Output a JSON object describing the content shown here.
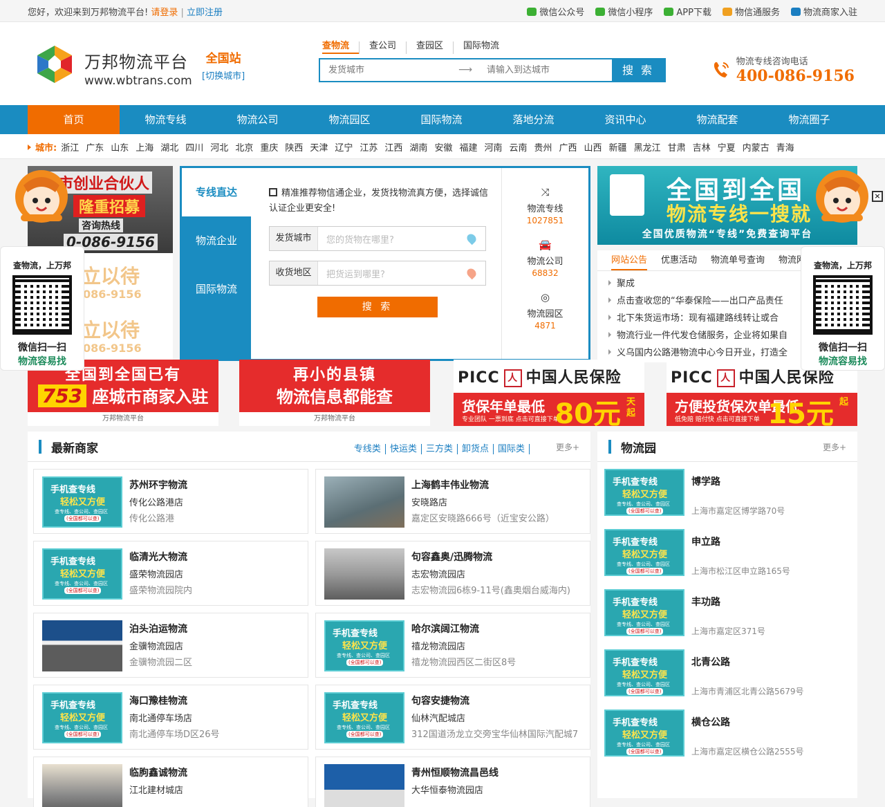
{
  "topbar": {
    "greeting": "您好，欢迎来到万邦物流平台!",
    "login": "请登录",
    "sep": "|",
    "register": "立即注册",
    "links": [
      {
        "icon": "wechat-icon",
        "label": "微信公众号",
        "color": "#3cb034"
      },
      {
        "icon": "miniprogram-icon",
        "label": "微信小程序",
        "color": "#3cb034"
      },
      {
        "icon": "download-icon",
        "label": "APP下载",
        "color": "#3cb034"
      },
      {
        "icon": "truck-icon",
        "label": "物信通服务",
        "color": "#f0a020"
      },
      {
        "icon": "merchant-icon",
        "label": "物流商家入驻",
        "color": "#1a7ec1"
      }
    ]
  },
  "header": {
    "logo_cn": "万邦物流平台",
    "logo_en": "www.wbtrans.com",
    "station": "全国站",
    "switch_city": "[切换城市]",
    "search_tabs": [
      "查物流",
      "查公司",
      "查园区",
      "国际物流"
    ],
    "from_placeholder": "发货城市",
    "to_placeholder": "请输入到达城市",
    "search_btn": "搜 索",
    "hotline_label": "物流专线咨询电话",
    "hotline": "400-086-9156",
    "accent": "#f06c00",
    "brand": "#1a8cc1"
  },
  "nav": [
    "首页",
    "物流专线",
    "物流公司",
    "物流园区",
    "国际物流",
    "落地分流",
    "资讯中心",
    "物流配套",
    "物流圈子"
  ],
  "cities": {
    "label": "城市:",
    "list": [
      "浙江",
      "广东",
      "山东",
      "上海",
      "湖北",
      "四川",
      "河北",
      "北京",
      "重庆",
      "陕西",
      "天津",
      "辽宁",
      "江苏",
      "江西",
      "湖南",
      "安徽",
      "福建",
      "河南",
      "云南",
      "贵州",
      "广西",
      "山西",
      "新疆",
      "黑龙江",
      "甘肃",
      "吉林",
      "宁夏",
      "内蒙古",
      "青海"
    ]
  },
  "left_ad": {
    "t1": "城市创业合伙人",
    "t2": "隆重招募",
    "t3": "咨询热线",
    "t4": "0-086-9156",
    "fade1": "立以待",
    "fade2": "086-9156"
  },
  "search_panel": {
    "tabs": [
      "专线直达",
      "物流企业",
      "国际物流"
    ],
    "note": "精准推荐物信通企业，发货找物流真方便，选择诚信认证企业更安全!",
    "from_label": "发货城市",
    "from_placeholder": "您的货物在哪里?",
    "to_label": "收货地区",
    "to_placeholder": "把货运到哪里?",
    "button": "搜 索",
    "stats": [
      {
        "icon": "shuffle-icon",
        "glyph": "⤨",
        "name": "物流专线",
        "value": "1027851"
      },
      {
        "icon": "car-icon",
        "glyph": "🚘",
        "name": "物流公司",
        "value": "68832"
      },
      {
        "icon": "lifebuoy-icon",
        "glyph": "◎",
        "name": "物流园区",
        "value": "4871"
      }
    ]
  },
  "right_ad": {
    "r1": "全国到全国",
    "r2": "物流专线一搜就",
    "r3": "全国优质物流“专线”免费查询平台"
  },
  "notice": {
    "tabs": [
      "网站公告",
      "优惠活动",
      "物流单号查询",
      "物流网"
    ],
    "items": [
      "聚成",
      "点击查收您的“华泰保险——出口产品责任",
      "北下朱货运市场：现有福建路线转让或合",
      "物流行业一件代发仓储服务，企业将如果自",
      "义乌国内公路港物流中心今日开业，打造全"
    ]
  },
  "float_qr": {
    "title": "查物流，上万邦",
    "line1": "微信扫一扫",
    "line2": "物流容易找"
  },
  "close_glyph": "×",
  "promos": [
    {
      "type": "red",
      "p1": "全国到全国已有",
      "num": "753",
      "p2": "座城市商家入驻",
      "foot": "万邦物流平台"
    },
    {
      "type": "red",
      "p1": "再小的县镇",
      "p2": "物流信息都能查",
      "foot": "万邦物流平台"
    },
    {
      "type": "picc",
      "brand": "PICC",
      "seal": "人",
      "company": "中国人民保险",
      "line": "货保年单最低",
      "amount": "80元",
      "unit": "天起",
      "small": "专业团队 一票到底 点击可直接下单"
    },
    {
      "type": "picc",
      "brand": "PICC",
      "seal": "人",
      "company": "中国人民保险",
      "line": "方便投货保次单最低",
      "amount": "15元",
      "unit": "起",
      "small": "低免赔 赔付快 点击可直接下单"
    }
  ],
  "merchants": {
    "title": "最新商家",
    "links": [
      "专线类",
      "快运类",
      "三方类",
      "卸货点",
      "国际类"
    ],
    "more": "更多+",
    "promo_thumb": {
      "a": "手机查专线",
      "b": "轻松又方便",
      "c": "查专线、查公司、查园区",
      "d": "(全国都可以查)"
    },
    "items": [
      {
        "name": "苏州环宇物流",
        "area": "传化公路港店",
        "addr": "传化公路港",
        "thumb": "teal"
      },
      {
        "name": "上海鹤丰伟业物流",
        "area": "安晓路店",
        "addr": "嘉定区安晓路666号（近宝安公路）",
        "thumb": "photo"
      },
      {
        "name": "临清光大物流",
        "area": "盛荣物流园店",
        "addr": "盛荣物流园院内",
        "thumb": "teal"
      },
      {
        "name": "句容鑫奥/迅腾物流",
        "area": "志宏物流园店",
        "addr": "志宏物流园6栋9-11号(鑫奥烟台威海内)",
        "thumb": "photo2"
      },
      {
        "name": "泊头泊运物流",
        "area": "金骥物流园店",
        "addr": "金骥物流园二区",
        "thumb": "photo3"
      },
      {
        "name": "哈尔滨阔江物流",
        "area": "禧龙物流园店",
        "addr": "禧龙物流园西区二街区8号",
        "thumb": "teal"
      },
      {
        "name": "海口豫桂物流",
        "area": "南北通停车场店",
        "addr": "南北通停车场D区26号",
        "thumb": "teal"
      },
      {
        "name": "句容安捷物流",
        "area": "仙林汽配城店",
        "addr": "312国道汤龙立交旁宝华仙林国际汽配城7",
        "thumb": "teal"
      },
      {
        "name": "临朐鑫诚物流",
        "area": "江北建材城店",
        "addr": "",
        "thumb": "photo4"
      },
      {
        "name": "青州恒顺物流昌邑线",
        "area": "大华恒泰物流园店",
        "addr": "",
        "thumb": "photo5"
      }
    ]
  },
  "parks": {
    "title": "物流园",
    "more": "更多+",
    "items": [
      {
        "name": "博学路",
        "addr": "上海市嘉定区博学路70号"
      },
      {
        "name": "申立路",
        "addr": "上海市松江区申立路165号"
      },
      {
        "name": "丰功路",
        "addr": "上海市嘉定区371号"
      },
      {
        "name": "北青公路",
        "addr": "上海市青浦区北青公路5679号"
      },
      {
        "name": "横仓公路",
        "addr": "上海市嘉定区横仓公路2555号"
      }
    ]
  }
}
